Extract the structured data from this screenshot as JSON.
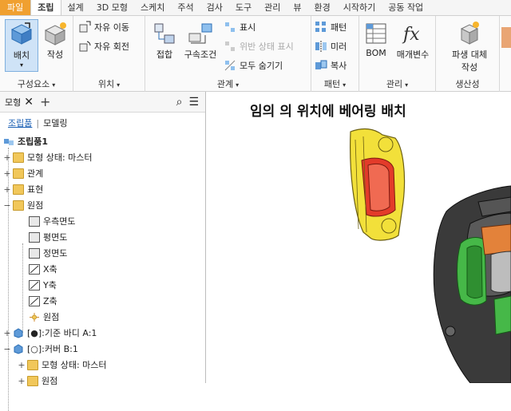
{
  "menu": {
    "tabs": [
      "파일",
      "조립",
      "설계",
      "3D 모형",
      "스케치",
      "주석",
      "검사",
      "도구",
      "관리",
      "뷰",
      "환경",
      "시작하기",
      "공동 작업"
    ]
  },
  "ribbon": {
    "component": {
      "title": "구성요소",
      "place": "배치",
      "create": "작성"
    },
    "position": {
      "title": "위치",
      "free_move": "자유 이동",
      "free_rotate": "자유 회전"
    },
    "relationships": {
      "title": "관계",
      "join": "접합",
      "constrain": "구속조건",
      "show": "표시",
      "show_sick": "위반 상태 표시",
      "hide_all": "모두 숨기기"
    },
    "pattern": {
      "title": "패턴",
      "pattern": "패턴",
      "mirror": "미러",
      "copy": "복사"
    },
    "manage": {
      "title": "관리",
      "bom": "BOM",
      "parameters": "매개변수"
    },
    "productivity": {
      "title": "생산성",
      "derive_line1": "파생 대체",
      "derive_line2": "작성"
    }
  },
  "browser": {
    "tab": "모형",
    "subtab_assembly": "조립품",
    "subtab_modeling": "모델링",
    "tree": [
      {
        "label": "조립품1",
        "bold": true
      },
      {
        "label": "모형 상태: 마스터"
      },
      {
        "label": "관계"
      },
      {
        "label": "표현"
      },
      {
        "label": "원점"
      },
      {
        "label": "우측면도"
      },
      {
        "label": "평면도"
      },
      {
        "label": "정면도"
      },
      {
        "label": "X축"
      },
      {
        "label": "Y축"
      },
      {
        "label": "Z축"
      },
      {
        "label": "원점"
      },
      {
        "label": "[●]:기준 바디 A:1"
      },
      {
        "label": "[○]:커버 B:1"
      },
      {
        "label": "모형 상태: 마스터"
      },
      {
        "label": "원점"
      }
    ]
  },
  "canvas": {
    "title": "임의 의 위치에 베어링 배치"
  },
  "colors": {
    "file_tab": "#f0a030",
    "selection": "#cfe3f7",
    "bearing_yellow": "#f2e03a",
    "bearing_red": "#e33b2a",
    "housing_dark": "#3a3a3a",
    "part_green": "#46b848",
    "part_orange": "#e3823a"
  }
}
